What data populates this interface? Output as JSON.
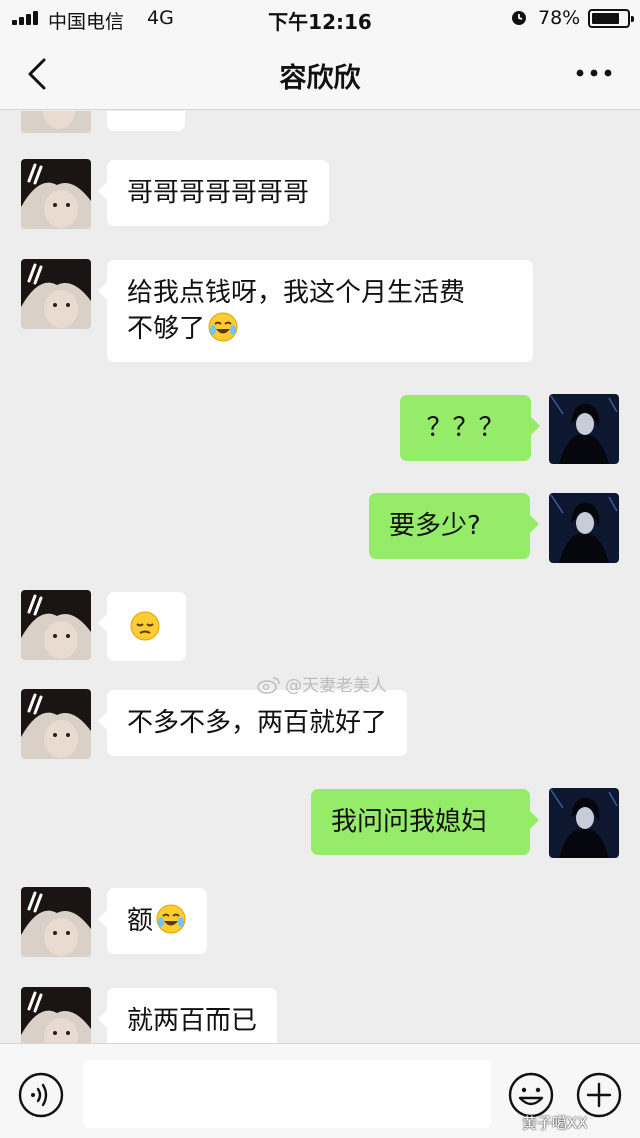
{
  "status_bar": {
    "carrier": "中国电信",
    "network": "4G",
    "time": "下午12:16",
    "battery": "78%",
    "battery_level": 0.78
  },
  "nav": {
    "title": "容欣欣"
  },
  "messages": [
    {
      "from": "contact",
      "text": "哥哥哥哥哥哥哥"
    },
    {
      "from": "contact",
      "line1": "给我点钱呀，我这个月生活费",
      "line2": "不够了",
      "emoji": "crying-laughing-emoji"
    },
    {
      "from": "me",
      "text": "？？？"
    },
    {
      "from": "me",
      "text": "要多少?"
    },
    {
      "from": "contact",
      "emoji": "pensive-face-emoji"
    },
    {
      "from": "contact",
      "text": "不多不多，两百就好了"
    },
    {
      "from": "me",
      "text": "我问问我媳妇"
    },
    {
      "from": "contact",
      "text": "额",
      "emoji": "crying-laughing-emoji"
    },
    {
      "from": "contact",
      "text": "就两百而已"
    }
  ],
  "watermark": "@天妻老美人",
  "corner_watermark": "黄子噶XX",
  "colors": {
    "my_bubble": "#95ec69",
    "their_bubble": "#ffffff",
    "background": "#ededed"
  }
}
